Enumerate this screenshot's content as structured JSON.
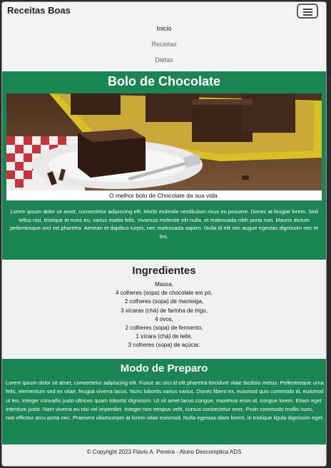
{
  "navbar": {
    "brand": "Receitas Boas",
    "links": [
      "Inicio",
      "Receitas",
      "Dietas"
    ]
  },
  "hero": {
    "title": "Bolo de Chocolate",
    "image_caption": "O melhor bolo de Chocolate da sua vida.",
    "text": "Lorem ipsum dolor sit amet, consectetur adipiscing elit. Morbi molestie vestibulum risus eu posuere. Donec at feugiat lorem. Sed tellus nisi, tristique et nunc eu, varius mattis felis. Vivamus molestie elit nulla, et malesuada nibh porta non. Mauris dictum pellentesque orci vel pharetra. Aenean et dapibus turpis, nec malesuada sapien. Nulla id elit nec augue egestas dignissim nec et leo."
  },
  "ingredients": {
    "title": "Ingredientes",
    "items": [
      "Massa,",
      "4 colheres (sopa) de chocolate em pó,",
      "2 colheres (sopa) de manteiga,",
      "3 xícaras (chá) de farinha de trigo,",
      "4 ovos,",
      "2 colheres (sopa) de fermento,",
      "1 xícara (chá) de leite,",
      "3 colheres (sopa) de açúcar."
    ]
  },
  "preparation": {
    "title": "Modo de Preparo",
    "text": "Lorem ipsum dolor sit amet, consectetur adipiscing elit. Fusce ac orci id elit pharetra tincidunt vitae facilisis metus. Pellentesque urna felis, elementum sed ex vitae, feugiat viverra lacus. Nunc lobortis varius varius. Donec libero ex, euismod quis commodo id, euismod ut leo. Integer convallis justo ultrices quam lobortis dignissim. Ut sit amet lacus congue, maximus enim id, congue lorem. Etiam eget interdum justo. Nam viverra eu nisi vel imperdiet. Integer non tempus velit, cursus consectetur eros. Proin commodo mollis nunc, non efficitur arcu porta nec. Praesent ullamcorper at lorem vitae euismod. Nulla egestas diam lorem, in tristique ligula dignissim eget."
  },
  "footer": {
    "text": "© Copyright 2023 Flavio A. Pereira - Aluno Descomplica ADS"
  },
  "colors": {
    "section_green": "#1b8553",
    "page_background": "#f0f1f3"
  }
}
